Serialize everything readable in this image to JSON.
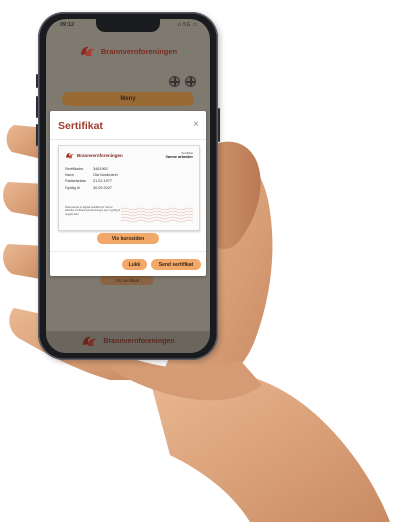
{
  "status_bar": {
    "time": "09:12",
    "icons": "..ıl 5G ▭"
  },
  "app": {
    "brand_name": "Brannvernforeningen",
    "menu_label": "Meny",
    "background_button_label": "Vis sertifikat",
    "footer_brand": "Brannvernforeningen"
  },
  "modal": {
    "title": "Sertifikat",
    "close_symbol": "×",
    "show_course_label": "Vis kurssiden",
    "close_label": "Lukk",
    "send_label": "Send sertifikat"
  },
  "certificate": {
    "brand": "Brannvernforeningen",
    "type_small": "Sertifikat",
    "type_main": "Varme arbeider",
    "fields": [
      {
        "label": "Sertifikatnr.",
        "value": "3461962"
      },
      {
        "label": "Navn",
        "value": "Ola Nordmann"
      },
      {
        "label": "Fødselsdato",
        "value": "21.02.1977"
      },
      {
        "label": "Gyldig til",
        "value": "30.09.2027"
      }
    ],
    "footnote": "Dokumentet er digitalt sertifikat for Varme arbeider fra Brannvernforeningen og er gyldig til oppgitt dato."
  },
  "colors": {
    "accent": "#f2a868",
    "title_red": "#a33a2c",
    "brand_dark": "#7a2a22",
    "overlay_bg": "#7e7a70"
  }
}
